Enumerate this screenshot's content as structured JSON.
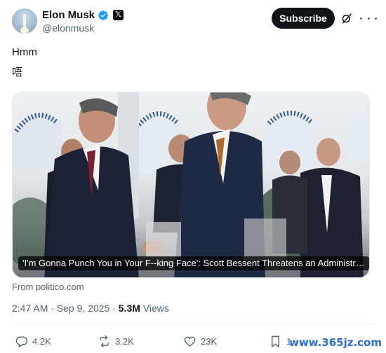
{
  "author": {
    "name": "Elon Musk",
    "handle": "@elonmusk"
  },
  "header": {
    "subscribe_label": "Subscribe"
  },
  "tweet": {
    "line1": "Hmm",
    "line2": "唔"
  },
  "media": {
    "caption": "'I'm Gonna Punch You in Your F--king Face': Scott Bessent Threatens an Administratio...",
    "source": "From politico.com"
  },
  "meta": {
    "time": "2:47 AM · Sep 9, 2025 · ",
    "views_count": "5.3M",
    "views_label": " Views"
  },
  "actions": {
    "replies": "4.2K",
    "reposts": "3.2K",
    "likes": "23K",
    "bookmarks": "1.5K"
  },
  "watermark": "www.365jz.com",
  "icons": [
    "verified-badge-icon",
    "x-logo-icon",
    "grok-icon",
    "more-icon",
    "reply-icon",
    "repost-icon",
    "like-icon",
    "bookmark-icon",
    "share-icon"
  ],
  "colors": {
    "verified": "#1d9bf0",
    "text": "#0f1419",
    "secondary": "#536471"
  }
}
